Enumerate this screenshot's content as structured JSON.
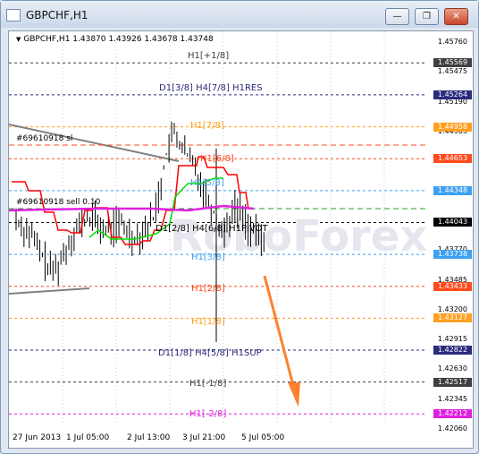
{
  "window": {
    "title": "GBPCHF,H1",
    "buttons": [
      "minimize",
      "restore",
      "close"
    ]
  },
  "chart": {
    "header": "GBPCHF,H1  1.43870 1.43926 1.43678 1.43748",
    "price_ticks": [
      "1.45760",
      "1.45475",
      "1.45190",
      "1.44905",
      "1.44620",
      "1.44335",
      "1.44050",
      "1.43770",
      "1.43485",
      "1.43200",
      "1.42915",
      "1.42630",
      "1.42345",
      "1.42060"
    ],
    "price_boxes": [
      {
        "value": "1.45569",
        "color": "#3f3f3f",
        "text": "#ffffff"
      },
      {
        "value": "1.45264",
        "color": "#2b2b7d",
        "text": "#ffffff"
      },
      {
        "value": "1.44958",
        "color": "#ffa020",
        "text": "#ffffff"
      },
      {
        "value": "1.44653",
        "color": "#ff4a1c",
        "text": "#ffffff"
      },
      {
        "value": "1.44348",
        "color": "#3ea0f0",
        "text": "#ffffff"
      },
      {
        "value": "1.44043",
        "color": "#000000",
        "text": "#ffffff"
      },
      {
        "value": "1.43738",
        "color": "#3ea0f0",
        "text": "#ffffff"
      },
      {
        "value": "1.43433",
        "color": "#ff4a1c",
        "text": "#ffffff"
      },
      {
        "value": "1.43127",
        "color": "#ffa020",
        "text": "#ffffff"
      },
      {
        "value": "1.42822",
        "color": "#2b2b7d",
        "text": "#ffffff"
      },
      {
        "value": "1.42517",
        "color": "#3f3f3f",
        "text": "#ffffff"
      },
      {
        "value": "1.42212",
        "color": "#e020e0",
        "text": "#ffffff"
      }
    ],
    "time_labels": [
      "27 Jun 2013",
      "1 Jul 05:00",
      "2 Jul 13:00",
      "3 Jul 21:00",
      "5 Jul 05:00"
    ],
    "level_labels": [
      {
        "text": "H1[+1/8]",
        "color": "#3f3f3f"
      },
      {
        "text": "D1[3/8] H4[7/8] H1RES",
        "color": "#2b2b7d"
      },
      {
        "text": "H1[7/8]",
        "color": "#ffa020"
      },
      {
        "text": "H1[6/8]",
        "color": "#ff4a1c"
      },
      {
        "text": "H1[5/8]",
        "color": "#3ea0f0"
      },
      {
        "text": "D1[2/8] H4[6/8] H1PIVOT",
        "color": "#000000"
      },
      {
        "text": "H1[3/8]",
        "color": "#3ea0f0"
      },
      {
        "text": "H1[2/8]",
        "color": "#ff4a1c"
      },
      {
        "text": "H1[1/8]",
        "color": "#ffa020"
      },
      {
        "text": "D1[1/8] H4[5/8] H1SUP",
        "color": "#2b2b7d"
      },
      {
        "text": "H1[-1/8]",
        "color": "#3f3f3f"
      },
      {
        "text": "H1[-2/8]",
        "color": "#e020e0"
      }
    ],
    "order_labels": [
      "#69610918 sl",
      "#69610918 sell 0.10"
    ],
    "watermark": "RoboForex"
  }
}
